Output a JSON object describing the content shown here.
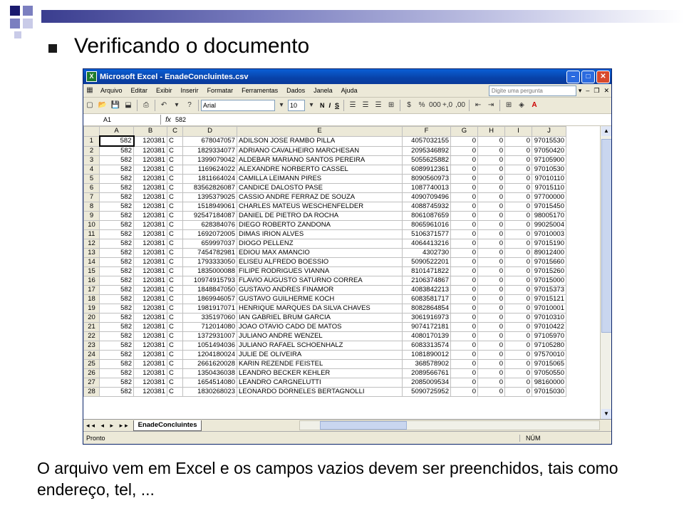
{
  "slide": {
    "title": "Verificando o documento",
    "caption": "O arquivo vem em Excel e os campos vazios devem ser preenchidos, tais como endereço, tel, ..."
  },
  "excel": {
    "window_title": "Microsoft Excel - EnadeConcluintes.csv",
    "menu": [
      "Arquivo",
      "Editar",
      "Exibir",
      "Inserir",
      "Formatar",
      "Ferramentas",
      "Dados",
      "Janela",
      "Ajuda"
    ],
    "ask_placeholder": "Digite uma pergunta",
    "font_name": "Arial",
    "font_size": "10",
    "name_box": "A1",
    "formula_value": "582",
    "columns": [
      "A",
      "B",
      "C",
      "D",
      "E",
      "F",
      "G",
      "H",
      "I",
      "J"
    ],
    "rows": [
      [
        "582",
        "120381",
        "C",
        "678047057",
        "ADILSON JOSE RAMBO PILLA",
        "4057032155",
        "0",
        "0",
        "0",
        "97015530"
      ],
      [
        "582",
        "120381",
        "C",
        "1829334077",
        "ADRIANO CAVALHEIRO MARCHESAN",
        "2095346892",
        "0",
        "0",
        "0",
        "97050420"
      ],
      [
        "582",
        "120381",
        "C",
        "1399079042",
        "ALDEBAR MARIANO SANTOS PEREIRA",
        "5055625882",
        "0",
        "0",
        "0",
        "97105900"
      ],
      [
        "582",
        "120381",
        "C",
        "1169624022",
        "ALEXANDRE NORBERTO CASSEL",
        "6089912361",
        "0",
        "0",
        "0",
        "97010530"
      ],
      [
        "582",
        "120381",
        "C",
        "1811664024",
        "CAMILLA LEIMANN PIRES",
        "8090560973",
        "0",
        "0",
        "0",
        "97010110"
      ],
      [
        "582",
        "120381",
        "C",
        "83562826087",
        "CANDICE DALOSTO PASE",
        "1087740013",
        "0",
        "0",
        "0",
        "97015110"
      ],
      [
        "582",
        "120381",
        "C",
        "1395379025",
        "CASSIO ANDRE FERRAZ DE SOUZA",
        "4090709496",
        "0",
        "0",
        "0",
        "97700000"
      ],
      [
        "582",
        "120381",
        "C",
        "1518949061",
        "CHARLES MATEUS WESCHENFELDER",
        "4088745932",
        "0",
        "0",
        "0",
        "97015450"
      ],
      [
        "582",
        "120381",
        "C",
        "92547184087",
        "DANIEL DE PIETRO DA ROCHA",
        "8061087659",
        "0",
        "0",
        "0",
        "98005170"
      ],
      [
        "582",
        "120381",
        "C",
        "628384076",
        "DIEGO ROBERTO ZANDONA",
        "8065961016",
        "0",
        "0",
        "0",
        "99025004"
      ],
      [
        "582",
        "120381",
        "C",
        "1692072005",
        "DIMAS IRION ALVES",
        "5106371577",
        "0",
        "0",
        "0",
        "97010003"
      ],
      [
        "582",
        "120381",
        "C",
        "659997037",
        "DIOGO PELLENZ",
        "4064413216",
        "0",
        "0",
        "0",
        "97015190"
      ],
      [
        "582",
        "120381",
        "C",
        "7454782981",
        "EDIOU MAX AMANCIO",
        "4302730",
        "0",
        "0",
        "0",
        "89012400"
      ],
      [
        "582",
        "120381",
        "C",
        "1793333050",
        "ELISEU ALFREDO BOESSIO",
        "5090522201",
        "0",
        "0",
        "0",
        "97015660"
      ],
      [
        "582",
        "120381",
        "C",
        "1835000088",
        "FILIPE RODRIGUES VIANNA",
        "8101471822",
        "0",
        "0",
        "0",
        "97015260"
      ],
      [
        "582",
        "120381",
        "C",
        "10974915793",
        "FLAVIO AUGUSTO SATURNO CORREA",
        "2106374867",
        "0",
        "0",
        "0",
        "97015000"
      ],
      [
        "582",
        "120381",
        "C",
        "1848847050",
        "GUSTAVO ANDRES FINAMOR",
        "4083842213",
        "0",
        "0",
        "0",
        "97015373"
      ],
      [
        "582",
        "120381",
        "C",
        "1869946057",
        "GUSTAVO GUILHERME KOCH",
        "6083581717",
        "0",
        "0",
        "0",
        "97015121"
      ],
      [
        "582",
        "120381",
        "C",
        "1981917071",
        "HENRIQUE MARQUES DA SILVA CHAVES",
        "8082864854",
        "0",
        "0",
        "0",
        "97010001"
      ],
      [
        "582",
        "120381",
        "C",
        "335197060",
        "IAN GABRIEL BRUM GARCIA",
        "3061916973",
        "0",
        "0",
        "0",
        "97010310"
      ],
      [
        "582",
        "120381",
        "C",
        "712014080",
        "JOAO OTAVIO CADO DE MATOS",
        "9074172181",
        "0",
        "0",
        "0",
        "97010422"
      ],
      [
        "582",
        "120381",
        "C",
        "1372931007",
        "JULIANO ANDRE WENZEL",
        "4080170139",
        "0",
        "0",
        "0",
        "97105970"
      ],
      [
        "582",
        "120381",
        "C",
        "1051494036",
        "JULIANO RAFAEL SCHOENHALZ",
        "6083313574",
        "0",
        "0",
        "0",
        "97105280"
      ],
      [
        "582",
        "120381",
        "C",
        "1204180024",
        "JULIE DE OLIVEIRA",
        "1081890012",
        "0",
        "0",
        "0",
        "97570010"
      ],
      [
        "582",
        "120381",
        "C",
        "2661620028",
        "KARIN REZENDE FEISTEL",
        "368578902",
        "0",
        "0",
        "0",
        "97015065"
      ],
      [
        "582",
        "120381",
        "C",
        "1350436038",
        "LEANDRO BECKER KEHLER",
        "2089566761",
        "0",
        "0",
        "0",
        "97050550"
      ],
      [
        "582",
        "120381",
        "C",
        "1654514080",
        "LEANDRO CARGNELUTTI",
        "2085009534",
        "0",
        "0",
        "0",
        "98160000"
      ],
      [
        "582",
        "120381",
        "C",
        "1830268023",
        "LEONARDO DORNELES BERTAGNOLLI",
        "5090725952",
        "0",
        "0",
        "0",
        "97015030"
      ]
    ],
    "sheet_tab": "EnadeConcluintes",
    "status_left": "Pronto",
    "status_num": "NÚM"
  }
}
